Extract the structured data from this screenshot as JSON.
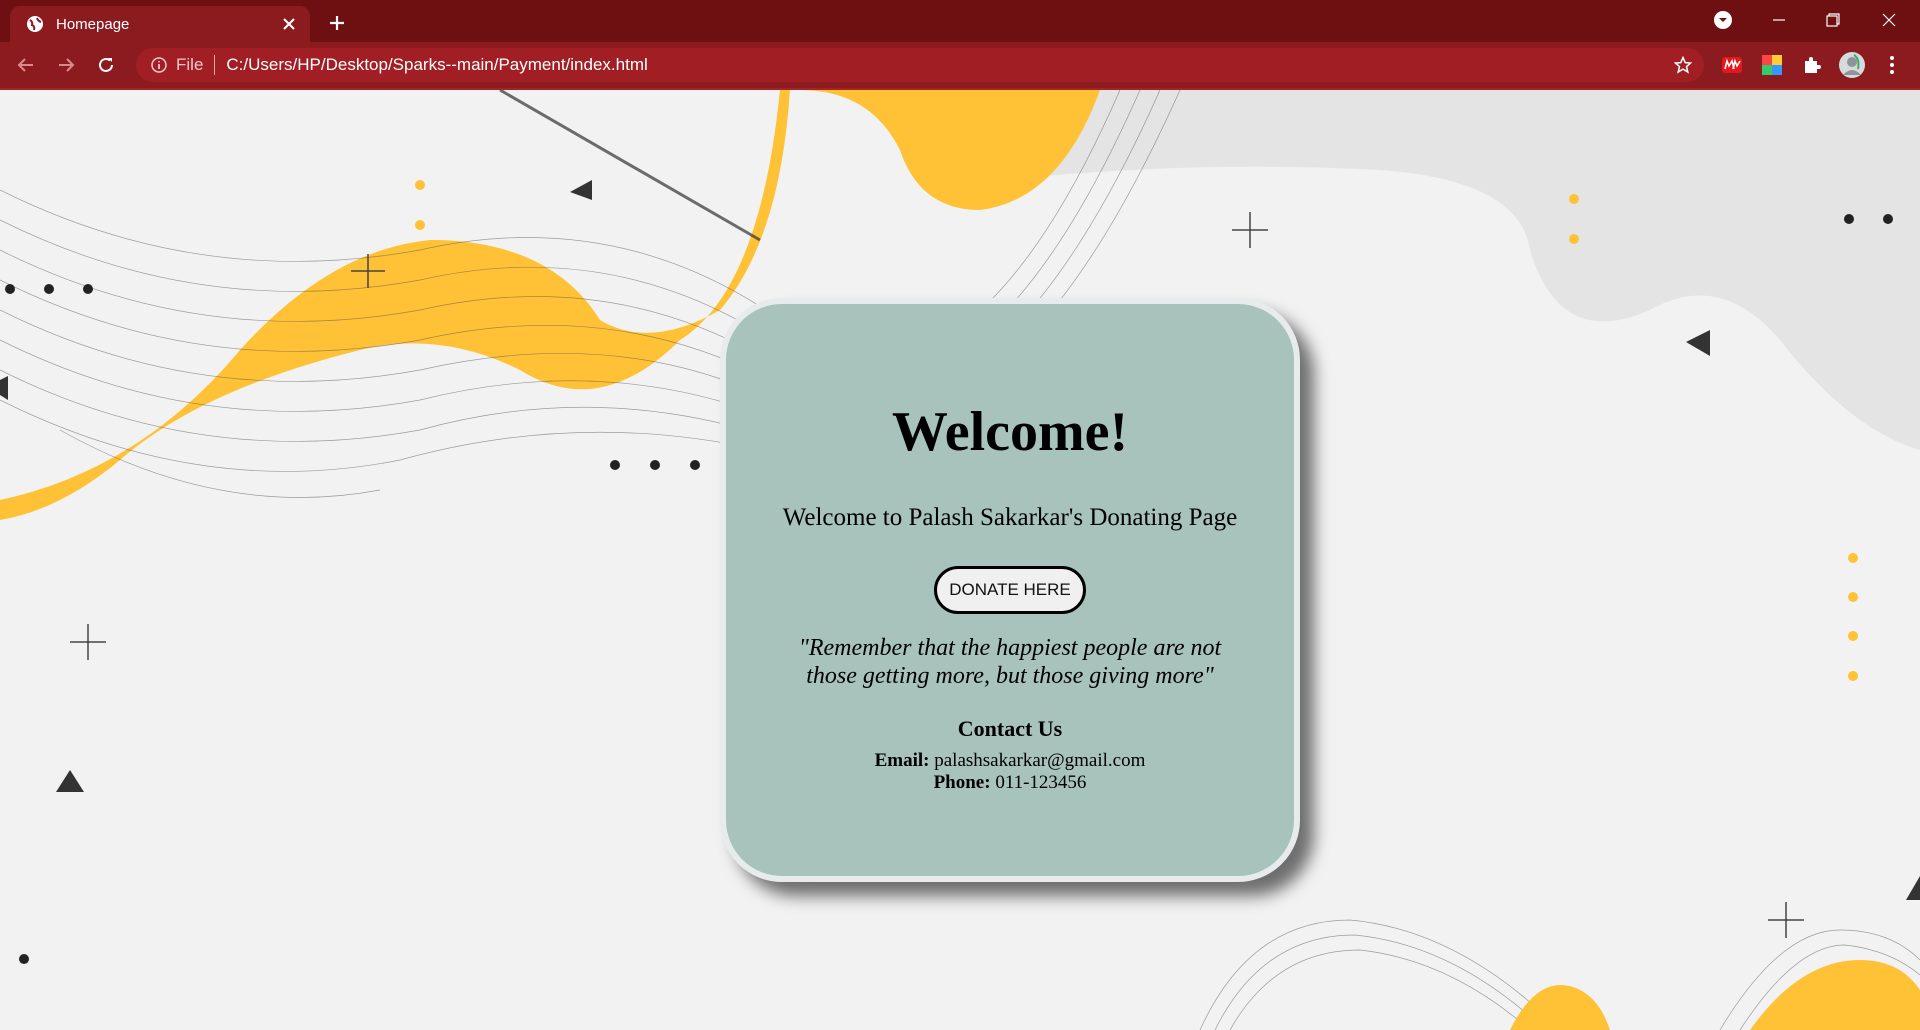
{
  "browser": {
    "tab_title": "Homepage",
    "omnibox_label": "File",
    "url": "C:/Users/HP/Desktop/Sparks--main/Payment/index.html",
    "icons": [
      "globe-icon",
      "close-icon",
      "plus-icon",
      "back-icon",
      "forward-icon",
      "reload-icon",
      "info-icon",
      "star-icon",
      "extension-icon",
      "puzzle-icon",
      "avatar",
      "menu-icon"
    ]
  },
  "colors": {
    "chrome_dark": "#6e0f12",
    "chrome": "#8c1b1f",
    "card": "#a7c3bc",
    "accent_yellow": "#ffc135"
  },
  "card": {
    "title": "Welcome!",
    "subtitle": "Welcome to Palash Sakarkar's Donating Page",
    "button_label": "DONATE HERE",
    "quote_line1": "\"Remember that the happiest people are not",
    "quote_line2": "those getting more, but those giving more\"",
    "contact_heading": "Contact Us",
    "email_label": "Email:",
    "email_value": "palashsakarkar@gmail.com",
    "phone_label": "Phone:",
    "phone_value": "011-123456"
  }
}
